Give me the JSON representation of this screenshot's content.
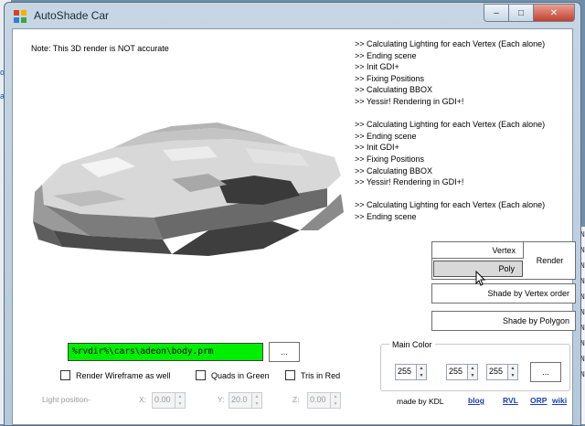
{
  "window": {
    "title": "AutoShade Car"
  },
  "caption_buttons": {
    "minimize": "–",
    "maximize": "□",
    "close": "✕"
  },
  "note": "Note: This 3D render is NOT accurate",
  "log": [
    ">> Calculating Lighting for each Vertex (Each alone)",
    ">> Ending scene",
    ">> Init GDI+",
    ">> Fixing Positions",
    ">> Calculating BBOX",
    ">> Yessir! Rendering in GDI+!",
    "",
    ">> Calculating Lighting for each Vertex (Each alone)",
    ">> Ending scene",
    ">> Init GDI+",
    ">> Fixing Positions",
    ">> Calculating BBOX",
    ">> Yessir! Rendering in GDI+!",
    "",
    ">> Calculating Lighting for each Vertex (Each alone)",
    ">> Ending scene"
  ],
  "render_panel": {
    "vertex_label": "Vertex",
    "poly_label": "Poly",
    "render_label": "Render",
    "shade_vertex_label": "Shade by Vertex order",
    "shade_polygon_label": "Shade by Polygon"
  },
  "path": {
    "value": "%rvdir%\\cars\\adeon\\body.prm",
    "browse_label": "..."
  },
  "options": {
    "wireframe": "Render Wireframe as well",
    "quads": "Quads in Green",
    "tris": "Tris in Red"
  },
  "light": {
    "label": "Light position-",
    "x_label": "X:",
    "x_value": "0.00",
    "y_label": "Y:",
    "y_value": "20.0",
    "z_label": "Z:",
    "z_value": "0.00"
  },
  "main_color": {
    "label": "Main Color",
    "r": "255",
    "g": "255",
    "b": "255",
    "pick_label": "..."
  },
  "footer": {
    "made_by": "made by KDL",
    "links": [
      "blog",
      "RVL",
      "ORP",
      "wiki"
    ]
  },
  "background_app": {
    "left_fragments": [
      "α",
      "as"
    ],
    "right_fragments": [
      "IN",
      "IN",
      "IN",
      "IN",
      "IN",
      "IN",
      "IN",
      "IN",
      "IN",
      "IN"
    ]
  },
  "colors": {
    "path_bg": "#00ee00",
    "close_button": "#c4402b",
    "link": "#1c3fae"
  },
  "icons": {
    "app": "app-icon",
    "cursor": "mouse-pointer-icon"
  }
}
